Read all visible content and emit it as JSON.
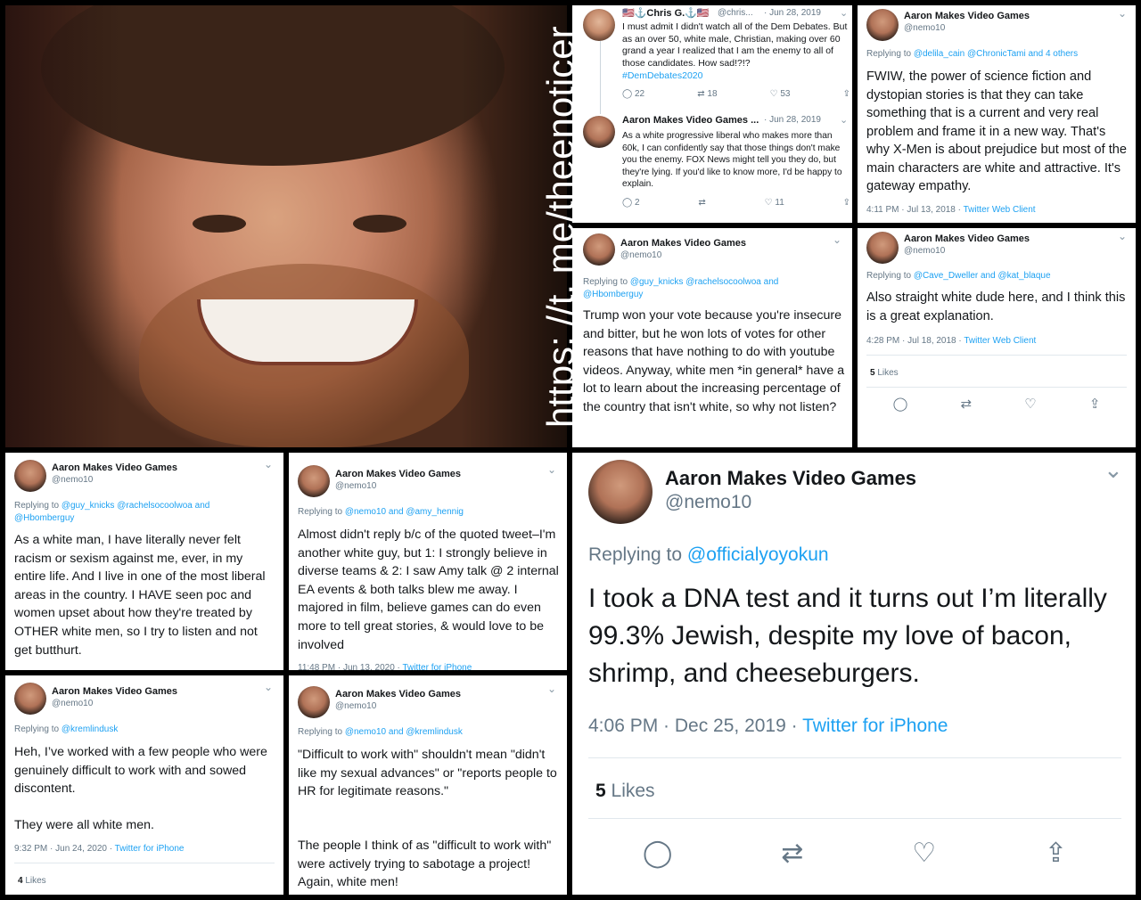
{
  "watermark": "https: //t. me/theenoticer",
  "panels": {
    "chris": {
      "name": "🇺🇸⚓Chris G.⚓🇺🇸",
      "handle": "@chris...",
      "date": "· Jun 28, 2019",
      "text": "I must admit I didn't watch all of the Dem Debates. But as an over 50, white male, Christian, making over 60 grand a year I realized that I am the enemy to all of those candidates. How sad!?!?",
      "hashtag": "#DemDebates2020",
      "replies": "22",
      "retweets": "18",
      "likes": "53"
    },
    "aaron_reply": {
      "name": "Aaron Makes Video Games ...",
      "date": "· Jun 28, 2019",
      "text": "As a white progressive liberal who makes more than 60k, I can confidently say that those things don't make you the enemy. FOX News might tell you they do, but they're lying. If you'd like to know more, I'd be happy to explain.",
      "replies": "2",
      "likes": "11"
    },
    "fwiw": {
      "name": "Aaron Makes Video Games",
      "handle": "@nemo10",
      "reply_prefix": "Replying to ",
      "reply_to": "@delila_cain @ChronicTami and 4 others",
      "text": "FWIW, the power of science fiction and dystopian stories is that they can take something that is a current and very real problem and frame it in a new way. That's why X-Men is about prejudice but most of the main characters are white and attractive. It's gateway empathy.",
      "time": "4:11 PM · Jul 13, 2018 · ",
      "source": "Twitter Web Client"
    },
    "trump": {
      "name": "Aaron Makes Video Games",
      "handle": "@nemo10",
      "reply_prefix": "Replying to ",
      "reply_to": "@guy_knicks @rachelsocoolwoa and @Hbomberguy",
      "text": "Trump won your vote because you're insecure and bitter, but he won lots of votes for other reasons that have nothing to do with youtube videos. Anyway, white men *in general* have a lot to learn about the increasing percentage of the country that isn't white, so why not listen?"
    },
    "straight": {
      "name": "Aaron Makes Video Games",
      "handle": "@nemo10",
      "reply_prefix": "Replying to ",
      "reply_to": "@Cave_Dweller and @kat_blaque",
      "text": "Also straight white dude here, and I think this is a great explanation.",
      "time": "4:28 PM · Jul 18, 2018 · ",
      "source": "Twitter Web Client",
      "likes_count": "5",
      "likes_label": " Likes"
    },
    "racism": {
      "name": "Aaron Makes Video Games",
      "handle": "@nemo10",
      "reply_prefix": "Replying to ",
      "reply_to": "@guy_knicks @rachelsocoolwoa and @Hbomberguy",
      "text": "As a white man, I have literally never felt racism or sexism against me, ever, in my entire life. And I live in one of the most liberal areas in the country. I HAVE seen poc and women upset about how they're treated by OTHER white men, so I try to listen and not get butthurt."
    },
    "amy": {
      "name": "Aaron Makes Video Games",
      "handle": "@nemo10",
      "reply_prefix": "Replying to ",
      "reply_to": "@nemo10 and @amy_hennig",
      "text": "Almost didn't reply b/c of the quoted tweet–I'm another white guy, but 1: I strongly believe in diverse teams & 2: I saw Amy talk @ 2 internal EA events & both talks blew me away. I majored in film, believe games can do even more to tell great stories, & would love to be involved",
      "time": "11:48 PM · Jun 13, 2020 · ",
      "source": "Twitter for iPhone"
    },
    "dna": {
      "name": "Aaron Makes Video Games",
      "handle": "@nemo10",
      "reply_prefix": "Replying to ",
      "reply_to": "@officialyoyokun",
      "text": "I took a DNA test and it turns out I’m literally 99.3% Jewish, despite my love of bacon, shrimp, and cheeseburgers.",
      "time": "4:06 PM · Dec 25, 2019 · ",
      "source": "Twitter for iPhone",
      "likes_count": "5",
      "likes_label": " Likes"
    },
    "heh": {
      "name": "Aaron Makes Video Games",
      "handle": "@nemo10",
      "reply_prefix": "Replying to ",
      "reply_to": "@kremlindusk",
      "text": "Heh, I’ve worked with a few people who were genuinely difficult to work with and sowed discontent.",
      "text2": "They were all white men.",
      "time": "9:32 PM · Jun 24, 2020 · ",
      "source": "Twitter for iPhone",
      "likes_count": "4",
      "likes_label": " Likes"
    },
    "difficult": {
      "name": "Aaron Makes Video Games",
      "handle": "@nemo10",
      "reply_prefix": "Replying to ",
      "reply_to": "@nemo10 and @kremlindusk",
      "text": "\"Difficult to work with\" shouldn't mean \"didn't like my sexual advances\" or \"reports people to HR for legitimate reasons.\"",
      "text2": "The people I think of as \"difficult to work with\" were actively trying to sabotage a project! Again, white men!"
    }
  },
  "colors": {
    "link": "#1da1f2",
    "muted": "#657786",
    "text": "#14171a"
  }
}
